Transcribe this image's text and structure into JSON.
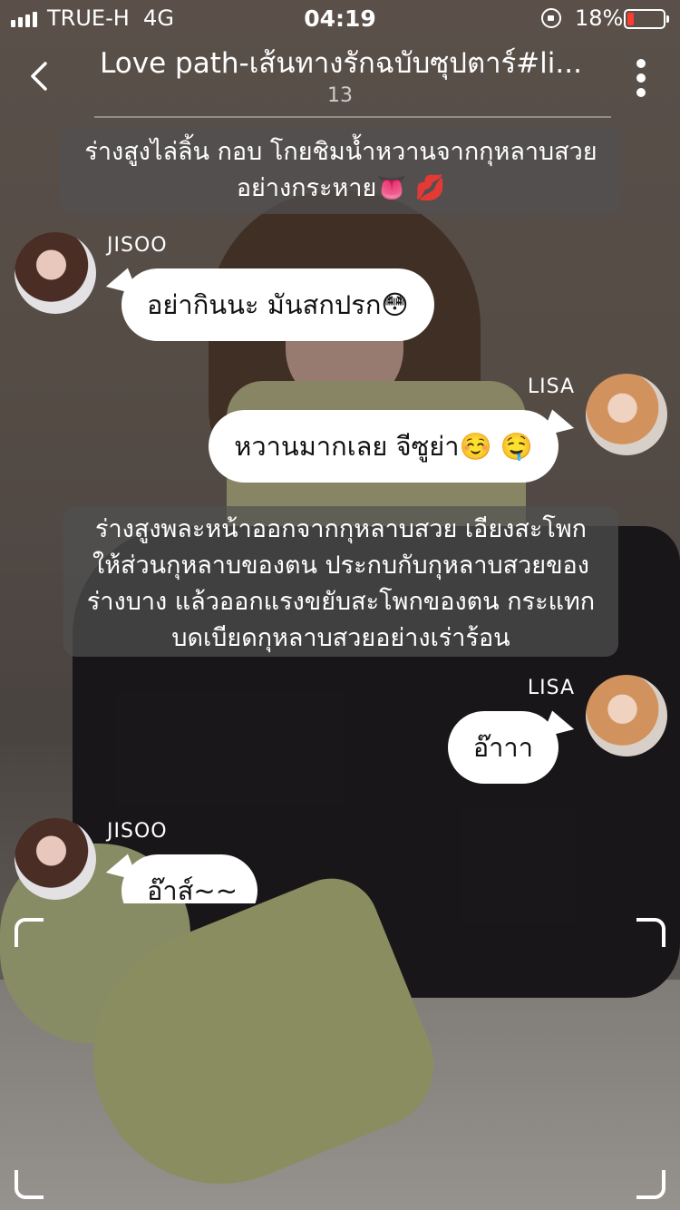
{
  "status_bar": {
    "carrier": "TRUE-H",
    "network": "4G",
    "time": "04:19",
    "battery_percent": "18%",
    "battery_level": 0.18,
    "battery_color": "#ff3b30"
  },
  "header": {
    "title": "Love path-เส้นทางรักฉบับซุปตาร์#li...",
    "chapter": "13",
    "back_icon": "chevron-left-icon",
    "more_icon": "vertical-ellipsis-icon"
  },
  "messages": [
    {
      "type": "narration",
      "text_line1": "ร่างสูงไล่ลิ้น กอบ โกยชิมน้ำหวานจากกุหลาบสวย",
      "text_line2": "อย่างกระหาย👅 💋"
    },
    {
      "type": "chat",
      "side": "left",
      "sender": "JISOO",
      "text": "อย่ากินนะ มันสกปรก😳"
    },
    {
      "type": "chat",
      "side": "right",
      "sender": "LISA",
      "text": "หวานมากเลย จีซูย่า☺️ 🤤"
    },
    {
      "type": "narration",
      "text_line1": "ร่างสูงพละหน้าออกจากกุหลาบสวย เอียงสะโพก",
      "text_line2": "ให้ส่วนกุหลาบของตน ประกบกับกุหลาบสวยของ",
      "text_line3": "ร่างบาง แล้วออกแรงขยับสะโพกของตน กระแทก",
      "text_line4": "บดเบียดกุหลาบสวยอย่างเร่าร้อน"
    },
    {
      "type": "chat",
      "side": "right",
      "sender": "LISA",
      "text": "อ๊าาา"
    },
    {
      "type": "chat",
      "side": "left",
      "sender": "JISOO",
      "text": "อ๊าส์~~"
    }
  ]
}
